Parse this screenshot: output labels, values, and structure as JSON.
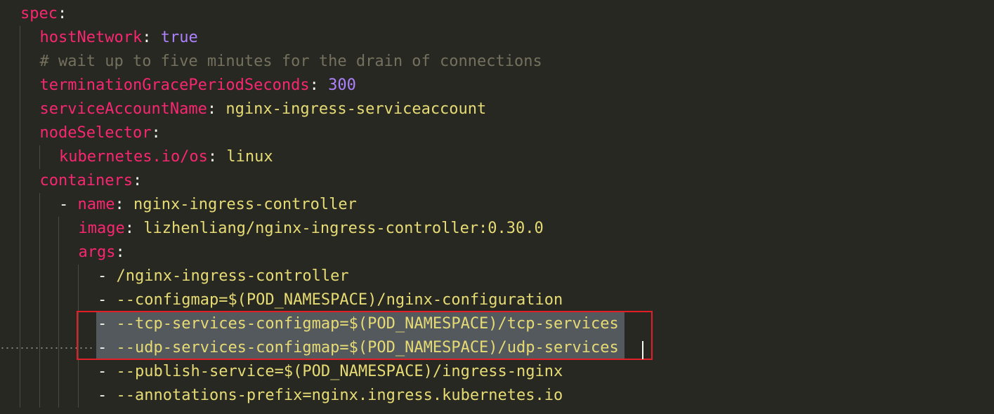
{
  "editor": {
    "lines": [
      {
        "indent": 0,
        "key": "spec",
        "sep": ":"
      },
      {
        "indent": 1,
        "key": "hostNetwork",
        "sep": ": ",
        "value": "true",
        "value_kind": "const"
      },
      {
        "indent": 1,
        "comment": "# wait up to five minutes for the drain of connections"
      },
      {
        "indent": 1,
        "key": "terminationGracePeriodSeconds",
        "sep": ": ",
        "value": "300",
        "value_kind": "const"
      },
      {
        "indent": 1,
        "key": "serviceAccountName",
        "sep": ": ",
        "value": "nginx-ingress-serviceaccount",
        "value_kind": "string"
      },
      {
        "indent": 1,
        "key": "nodeSelector",
        "sep": ":"
      },
      {
        "indent": 2,
        "key": "kubernetes.io/os",
        "sep": ": ",
        "value": "linux",
        "value_kind": "string"
      },
      {
        "indent": 1,
        "key": "containers",
        "sep": ":"
      },
      {
        "indent": 2,
        "dash": "- ",
        "key": "name",
        "sep": ": ",
        "value": "nginx-ingress-controller",
        "value_kind": "string"
      },
      {
        "indent": 3,
        "key": "image",
        "sep": ": ",
        "value": "lizhenliang/nginx-ingress-controller:0.30.0",
        "value_kind": "string"
      },
      {
        "indent": 3,
        "key": "args",
        "sep": ":"
      },
      {
        "indent": 4,
        "dash": "- ",
        "value": "/nginx-ingress-controller",
        "value_kind": "string"
      },
      {
        "indent": 4,
        "dash": "- ",
        "value": "--configmap=$(POD_NAMESPACE)/nginx-configuration",
        "value_kind": "string"
      },
      {
        "indent": 4,
        "dash": "- ",
        "value": "--tcp-services-configmap=$(POD_NAMESPACE)/tcp-services",
        "value_kind": "string",
        "selected": true
      },
      {
        "indent": 4,
        "dash": "- ",
        "value": "--udp-services-configmap=$(POD_NAMESPACE)/udp-services",
        "value_kind": "string",
        "selected": true,
        "current_line": true
      },
      {
        "indent": 4,
        "dash": "- ",
        "value": "--publish-service=$(POD_NAMESPACE)/ingress-nginx",
        "value_kind": "string"
      },
      {
        "indent": 4,
        "dash": "- ",
        "value": "--annotations-prefix=nginx.ingress.kubernetes.io",
        "value_kind": "string"
      }
    ]
  },
  "colors": {
    "background": "#272822",
    "key": "#f92672",
    "string": "#e6db74",
    "constant": "#ae81ff",
    "comment": "#75715e",
    "selection": "#54595e",
    "highlight_box": "#e21f26"
  }
}
